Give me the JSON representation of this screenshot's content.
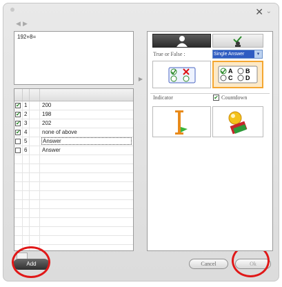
{
  "window": {
    "close_glyph": "✕",
    "minimize_glyph": "⌄"
  },
  "nav": {
    "prev": "◀",
    "next": "▶"
  },
  "question": {
    "text": "192+8="
  },
  "answers": [
    {
      "number": "1",
      "text": "200",
      "checked": true
    },
    {
      "number": "2",
      "text": "198",
      "checked": true
    },
    {
      "number": "3",
      "text": "202",
      "checked": true
    },
    {
      "number": "4",
      "text": "none of above",
      "checked": true
    },
    {
      "number": "5",
      "text": "Answer",
      "checked": false
    },
    {
      "number": "6",
      "text": "Answer",
      "checked": false
    }
  ],
  "checkmark": "✔",
  "buttons": {
    "add": "Add",
    "cancel": "Cancel",
    "ok": "Ok"
  },
  "splitter": "▶",
  "settings": {
    "type_label": "True or False :",
    "answer_type": "Single Answer",
    "dropdown_arrow": "▾",
    "indicator_label": "Indicator",
    "countdown_label": "Countdown",
    "countdown_checked": true,
    "sa_options": [
      "A",
      "B",
      "C",
      "D"
    ]
  },
  "colors": {
    "highlight_circle": "#e01818",
    "selected_card": "#f4a630",
    "check_green": "#2a8a2a"
  }
}
